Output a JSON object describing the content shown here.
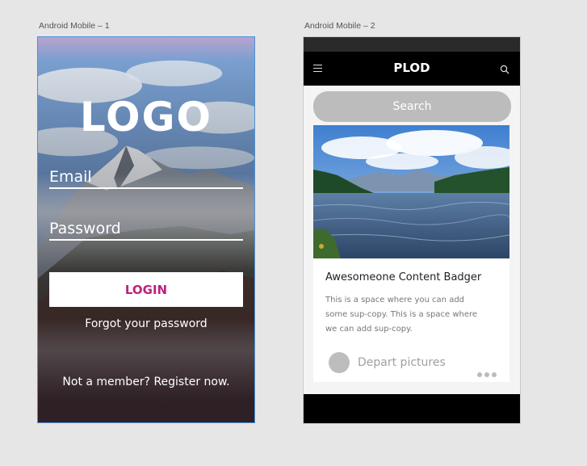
{
  "artboards": {
    "first_label": "Android Mobile – 1",
    "second_label": "Android Mobile – 2"
  },
  "login": {
    "logo_text": "LOGO",
    "email_placeholder": "Email",
    "password_placeholder": "Password",
    "login_button": "LOGIN",
    "forgot_link": "Forgot your password",
    "register_link": "Not a member? Register now.",
    "accent_color": "#c0207a"
  },
  "feed": {
    "app_title": "PLOD",
    "menu_icon": "hamburger-icon",
    "search_icon": "magnifier-icon",
    "search_placeholder": "Search",
    "card": {
      "title": "Awesomeone Content Badger",
      "body": "This is a space where you can add some sup-copy. This is a space where we can add sup-copy.",
      "meta_label": "Depart pictures",
      "more_icon": "more-dots-icon"
    }
  }
}
